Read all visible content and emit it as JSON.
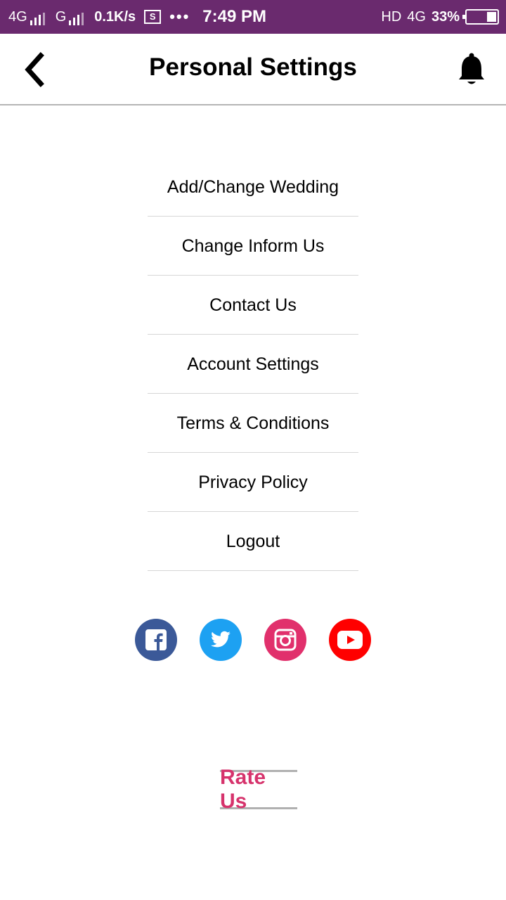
{
  "status_bar": {
    "net1": "4G",
    "net2": "G",
    "speed": "0.1K/s",
    "s_badge": "S",
    "more": "•••",
    "time": "7:49 PM",
    "hd": "HD",
    "net3": "4G",
    "battery_percent": "33%",
    "background": "#6a2a6e"
  },
  "header": {
    "title": "Personal Settings",
    "back_icon": "chevron-left-icon",
    "bell_icon": "bell-icon"
  },
  "menu": {
    "items": [
      {
        "label": "Add/Change Wedding"
      },
      {
        "label": "Change Inform Us"
      },
      {
        "label": "Contact Us"
      },
      {
        "label": "Account Settings"
      },
      {
        "label": "Terms & Conditions"
      },
      {
        "label": "Privacy Policy"
      },
      {
        "label": "Logout"
      }
    ]
  },
  "social": {
    "links": [
      {
        "name": "facebook-icon",
        "color": "#3b5998"
      },
      {
        "name": "twitter-icon",
        "color": "#1da1f2"
      },
      {
        "name": "instagram-icon",
        "color": "#e1306c"
      },
      {
        "name": "youtube-icon",
        "color": "#ff0000"
      }
    ]
  },
  "rate": {
    "label": "Rate Us",
    "color": "#d6336c"
  }
}
